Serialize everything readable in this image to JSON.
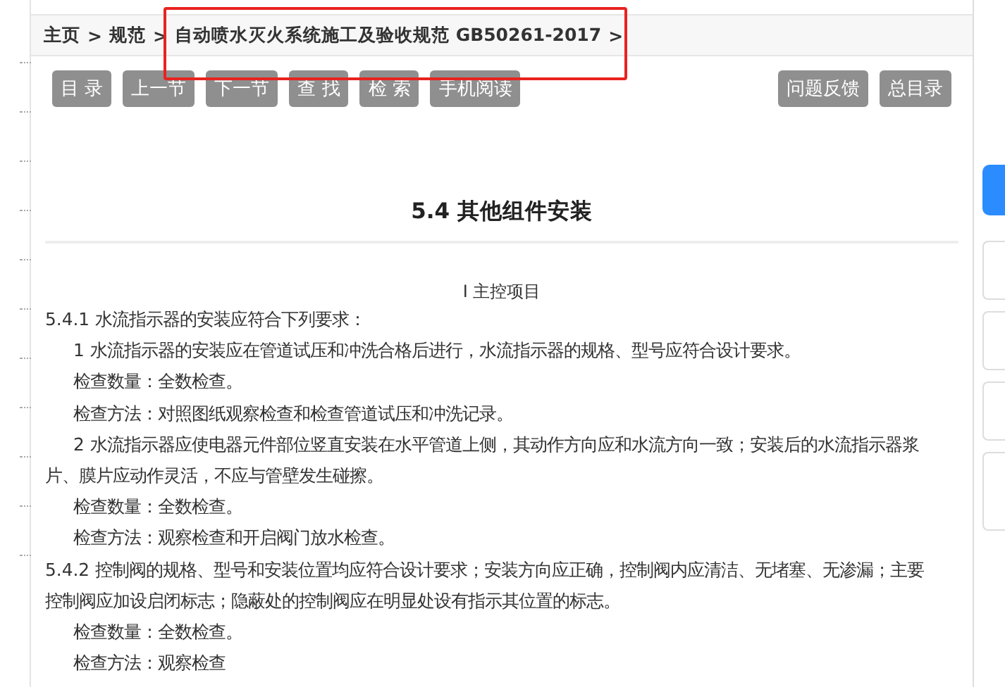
{
  "breadcrumb": [
    {
      "label": "主页",
      "sep": ">"
    },
    {
      "label": "规范",
      "sep": ">"
    },
    {
      "label": "自动喷水灭火系统施工及验收规范 GB50261-2017",
      "sep": ">"
    }
  ],
  "toolbar": {
    "left": [
      "目 录",
      "上一节",
      "下一节",
      "查 找",
      "检 索",
      "手机阅读"
    ],
    "right": [
      "问题反馈",
      "总目录"
    ]
  },
  "section_title": "5.4 其他组件安装",
  "subheading": "Ⅰ 主控项目",
  "paragraphs": [
    {
      "kind": "clause",
      "text": "5.4.1 水流指示器的安装应符合下列要求："
    },
    {
      "kind": "item",
      "text": "1 水流指示器的安装应在管道试压和冲洗合格后进行，水流指示器的规格、型号应符合设计要求。"
    },
    {
      "kind": "item",
      "text": "检查数量：全数检查。"
    },
    {
      "kind": "item",
      "text": "检查方法：对照图纸观察检查和检查管道试压和冲洗记录。"
    },
    {
      "kind": "item",
      "text": "2 水流指示器应使电器元件部位竖直安装在水平管道上侧，其动作方向应和水流方向一致；安装后的水流指示器浆片、膜片应动作灵活，不应与管壁发生碰擦。"
    },
    {
      "kind": "item",
      "text": "检查数量：全数检查。"
    },
    {
      "kind": "item",
      "text": "检查方法：观察检查和开启阀门放水检查。"
    },
    {
      "kind": "clause",
      "text": "5.4.2 控制阀的规格、型号和安装位置均应符合设计要求；安装方向应正确，控制阀内应清洁、无堵塞、无渗漏；主要控制阀应加设启闭标志；隐蔽处的控制阀应在明显处设有指示其位置的标志。"
    },
    {
      "kind": "item",
      "text": "检查数量：全数检查。"
    },
    {
      "kind": "item",
      "text": "检查方法：观察检查"
    }
  ]
}
